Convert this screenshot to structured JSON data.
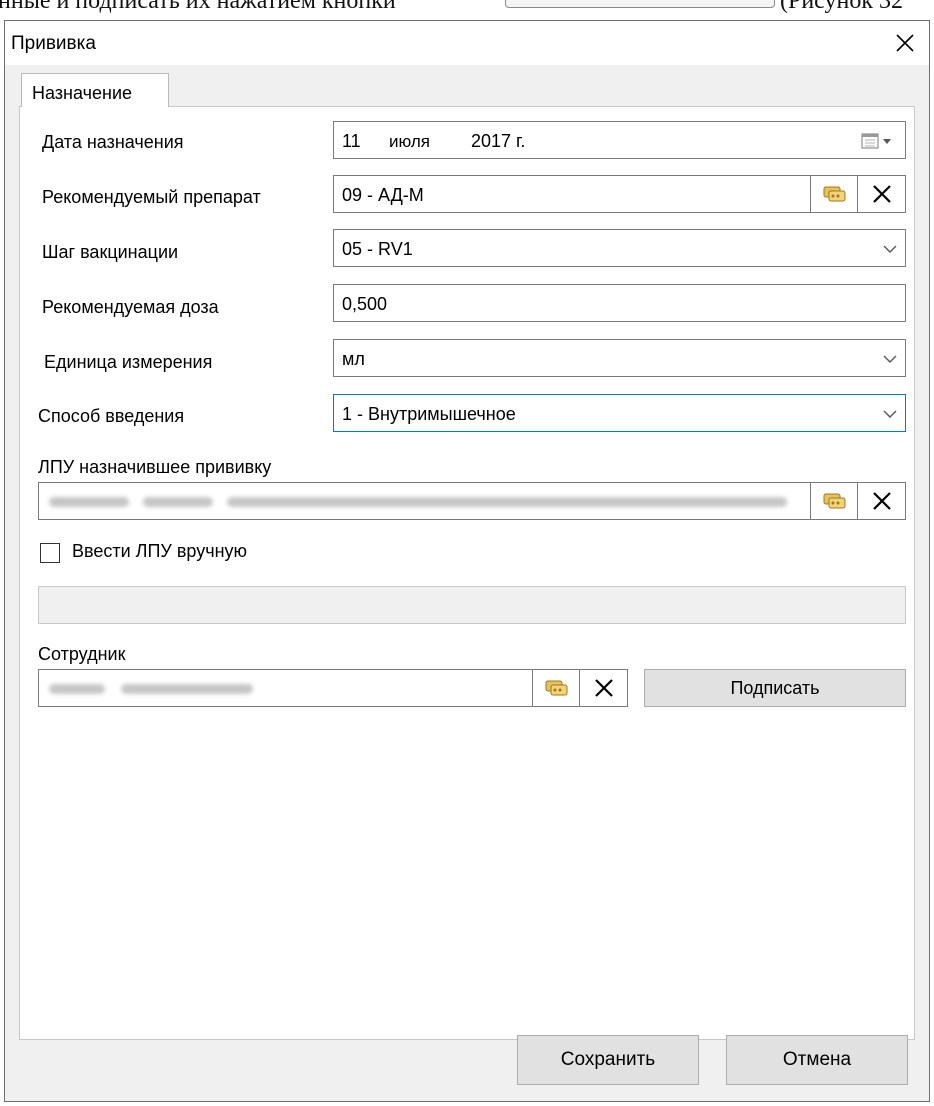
{
  "document": {
    "text_left": "нные и подписать их нажатием кнопки",
    "text_right": "(Рисунок 32"
  },
  "window": {
    "title": "Прививка",
    "close_icon": "close-icon"
  },
  "tabs": [
    {
      "label": "Назначение",
      "active": true
    }
  ],
  "form": {
    "appointment_date": {
      "label": "Дата назначения",
      "day": "11",
      "month": "июля",
      "year": "2017 г.",
      "icon": "calendar-dropdown-icon"
    },
    "recommended_drug": {
      "label": "Рекомендуемый препарат",
      "value": "09 - АД-М"
    },
    "vaccination_step": {
      "label": "Шаг вакцинации",
      "value": "05 - RV1"
    },
    "recommended_dose": {
      "label": "Рекомендуемая доза",
      "value": "0,500"
    },
    "unit": {
      "label": "Единица измерения",
      "value": "мл"
    },
    "route": {
      "label": "Способ введения",
      "value": "1 - Внутримышечное"
    },
    "lpu": {
      "label": "ЛПУ назначившее прививку"
    },
    "manual_lpu": {
      "label": "Ввести ЛПУ вручную",
      "checked": false
    },
    "employee": {
      "label": "Сотрудник",
      "sign_button": "Подписать"
    }
  },
  "footer": {
    "save": "Сохранить",
    "cancel": "Отмена"
  }
}
